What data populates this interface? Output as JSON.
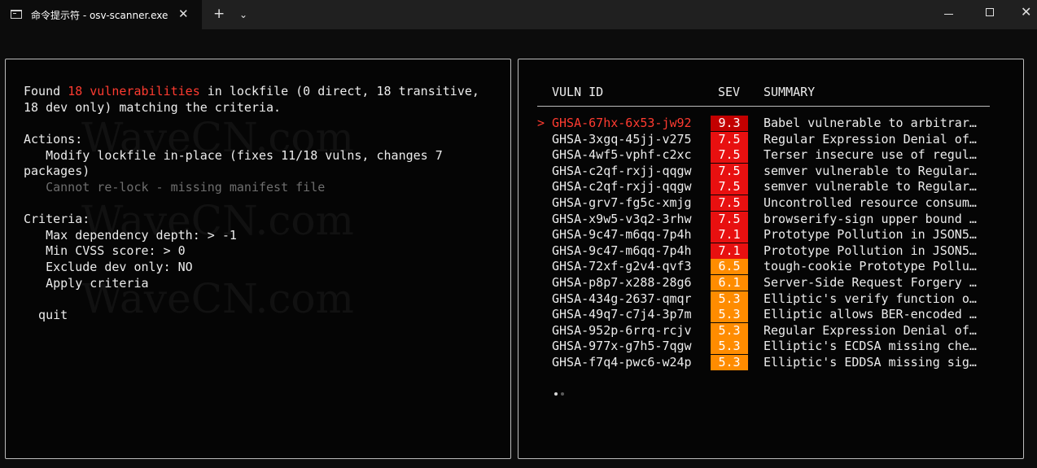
{
  "window": {
    "tab_title": "命令提示符 - osv-scanner.exe",
    "close_tab_glyph": "✕",
    "new_tab_glyph": "+",
    "dropdown_glyph": "⌄",
    "close_window_glyph": "✕"
  },
  "left_panel": {
    "found_prefix": "Found ",
    "found_count": "18 vulnerabilities",
    "found_suffix": " in lockfile (0 direct, 18 transitive,",
    "found_line2": "18 dev only) matching the criteria.",
    "actions_heading": "Actions:",
    "action_modify_line1": "   Modify lockfile in-place (fixes 11/18 vulns, changes 7",
    "action_modify_line2": "packages)",
    "action_relock": "   Cannot re-lock - missing manifest file",
    "criteria_heading": "Criteria:",
    "criteria_depth": "   Max dependency depth: > -1",
    "criteria_cvss": "   Min CVSS score: > 0",
    "criteria_exclude": "   Exclude dev only: NO",
    "criteria_apply": "   Apply criteria",
    "quit": "  quit"
  },
  "watermark": "WaveCN.com",
  "table": {
    "col_id": "VULN ID",
    "col_sev": "SEV",
    "col_summary": "SUMMARY",
    "cursor": ">",
    "rows": [
      {
        "id": "GHSA-67hx-6x53-jw92",
        "sev": "9.3",
        "summary": "Babel vulnerable to arbitrar…",
        "color": "#c30000"
      },
      {
        "id": "GHSA-3xgq-45jj-v275",
        "sev": "7.5",
        "summary": "Regular Expression Denial of…",
        "color": "#e81010"
      },
      {
        "id": "GHSA-4wf5-vphf-c2xc",
        "sev": "7.5",
        "summary": "Terser insecure use of regul…",
        "color": "#e81010"
      },
      {
        "id": "GHSA-c2qf-rxjj-qqgw",
        "sev": "7.5",
        "summary": "semver vulnerable to Regular…",
        "color": "#e81010"
      },
      {
        "id": "GHSA-c2qf-rxjj-qqgw",
        "sev": "7.5",
        "summary": "semver vulnerable to Regular…",
        "color": "#e81010"
      },
      {
        "id": "GHSA-grv7-fg5c-xmjg",
        "sev": "7.5",
        "summary": "Uncontrolled resource consum…",
        "color": "#e81010"
      },
      {
        "id": "GHSA-x9w5-v3q2-3rhw",
        "sev": "7.5",
        "summary": "browserify-sign upper bound …",
        "color": "#e81010"
      },
      {
        "id": "GHSA-9c47-m6qq-7p4h",
        "sev": "7.1",
        "summary": "Prototype Pollution in JSON5…",
        "color": "#e81010"
      },
      {
        "id": "GHSA-9c47-m6qq-7p4h",
        "sev": "7.1",
        "summary": "Prototype Pollution in JSON5…",
        "color": "#e81010"
      },
      {
        "id": "GHSA-72xf-g2v4-qvf3",
        "sev": "6.5",
        "summary": "tough-cookie Prototype Pollu…",
        "color": "#ff8c00"
      },
      {
        "id": "GHSA-p8p7-x288-28g6",
        "sev": "6.1",
        "summary": "Server-Side Request Forgery …",
        "color": "#ff8c00"
      },
      {
        "id": "GHSA-434g-2637-qmqr",
        "sev": "5.3",
        "summary": "Elliptic's verify function o…",
        "color": "#ff8c00"
      },
      {
        "id": "GHSA-49q7-c7j4-3p7m",
        "sev": "5.3",
        "summary": "Elliptic allows BER-encoded …",
        "color": "#ff8c00"
      },
      {
        "id": "GHSA-952p-6rrq-rcjv",
        "sev": "5.3",
        "summary": "Regular Expression Denial of…",
        "color": "#ff8c00"
      },
      {
        "id": "GHSA-977x-g7h5-7qgw",
        "sev": "5.3",
        "summary": "Elliptic's ECDSA missing che…",
        "color": "#ff8c00"
      },
      {
        "id": "GHSA-f7q4-pwc6-w24p",
        "sev": "5.3",
        "summary": "Elliptic's EDDSA missing sig…",
        "color": "#ff8c00"
      }
    ],
    "selected_index": 0,
    "page_dots": 2,
    "current_page": 1
  },
  "colors": {
    "highlight_red": "#ff3b30",
    "text": "#ececec",
    "dim": "#6e6e6e"
  }
}
